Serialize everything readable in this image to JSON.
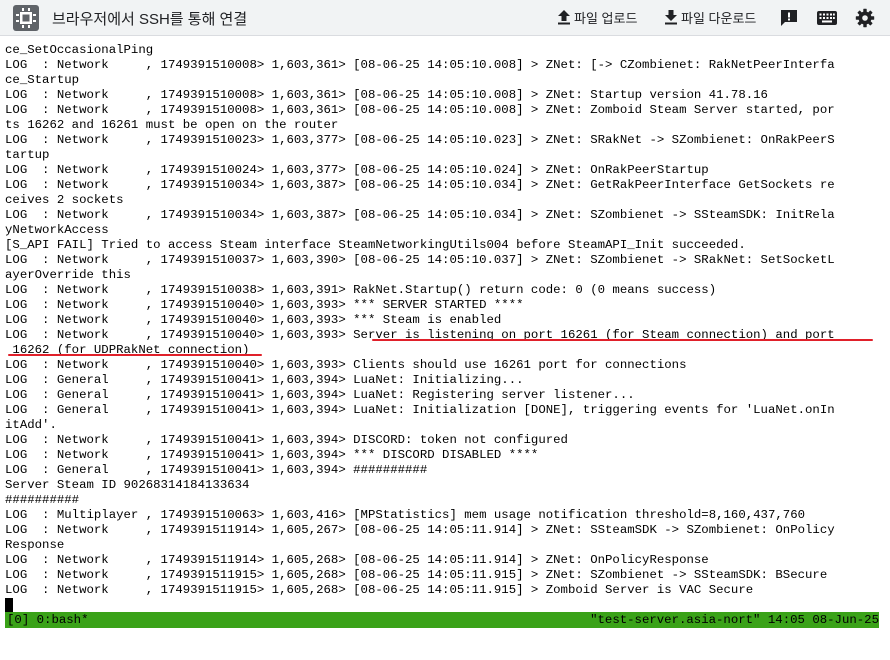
{
  "header": {
    "title": "브라우저에서 SSH를 통해 연결",
    "upload_label": "파일 업로드",
    "download_label": "파일 다운로드",
    "icons": [
      "app-chip-icon",
      "upload-icon",
      "download-icon",
      "feedback-icon",
      "keyboard-icon",
      "settings-gear-icon"
    ],
    "accent_color": "#5f6368"
  },
  "terminal": {
    "lines": [
      "ce_SetOccasionalPing",
      "LOG  : Network     , 1749391510008> 1,603,361> [08-06-25 14:05:10.008] > ZNet: [-> CZombienet: RakNetPeerInterfa",
      "ce_Startup",
      "LOG  : Network     , 1749391510008> 1,603,361> [08-06-25 14:05:10.008] > ZNet: Startup version 41.78.16",
      "LOG  : Network     , 1749391510008> 1,603,361> [08-06-25 14:05:10.008] > ZNet: Zomboid Steam Server started, por",
      "ts 16262 and 16261 must be open on the router",
      "LOG  : Network     , 1749391510023> 1,603,377> [08-06-25 14:05:10.023] > ZNet: SRakNet -> SZombienet: OnRakPeerS",
      "tartup",
      "LOG  : Network     , 1749391510024> 1,603,377> [08-06-25 14:05:10.024] > ZNet: OnRakPeerStartup",
      "LOG  : Network     , 1749391510034> 1,603,387> [08-06-25 14:05:10.034] > ZNet: GetRakPeerInterface GetSockets re",
      "ceives 2 sockets",
      "LOG  : Network     , 1749391510034> 1,603,387> [08-06-25 14:05:10.034] > ZNet: SZombienet -> SSteamSDK: InitRela",
      "yNetworkAccess",
      "[S_API FAIL] Tried to access Steam interface SteamNetworkingUtils004 before SteamAPI_Init succeeded.",
      "LOG  : Network     , 1749391510037> 1,603,390> [08-06-25 14:05:10.037] > ZNet: SZombienet -> SRakNet: SetSocketL",
      "ayerOverride this",
      "LOG  : Network     , 1749391510038> 1,603,391> RakNet.Startup() return code: 0 (0 means success)",
      "LOG  : Network     , 1749391510040> 1,603,393> *** SERVER STARTED ****",
      "LOG  : Network     , 1749391510040> 1,603,393> *** Steam is enabled",
      "LOG  : Network     , 1749391510040> 1,603,393> Server is listening on port 16261 (for Steam connection) and port",
      " 16262 (for UDPRakNet connection)",
      "LOG  : Network     , 1749391510040> 1,603,393> Clients should use 16261 port for connections",
      "LOG  : General     , 1749391510041> 1,603,394> LuaNet: Initializing...",
      "LOG  : General     , 1749391510041> 1,603,394> LuaNet: Registering server listener...",
      "LOG  : General     , 1749391510041> 1,603,394> LuaNet: Initialization [DONE], triggering events for 'LuaNet.onIn",
      "itAdd'.",
      "LOG  : Network     , 1749391510041> 1,603,394> DISCORD: token not configured",
      "LOG  : Network     , 1749391510041> 1,603,394> *** DISCORD DISABLED ****",
      "LOG  : General     , 1749391510041> 1,603,394> ##########",
      "Server Steam ID 90268314184133634",
      "##########",
      "LOG  : Multiplayer , 1749391510063> 1,603,416> [MPStatistics] mem usage notification threshold=8,160,437,760",
      "LOG  : Network     , 1749391511914> 1,605,267> [08-06-25 14:05:11.914] > ZNet: SSteamSDK -> SZombienet: OnPolicy",
      "Response",
      "LOG  : Network     , 1749391511914> 1,605,268> [08-06-25 14:05:11.914] > ZNet: OnPolicyResponse",
      "LOG  : Network     , 1749391511915> 1,605,268> [08-06-25 14:05:11.915] > ZNet: SZombienet -> SSteamSDK: BSecure",
      "LOG  : Network     , 1749391511915> 1,605,268> [08-06-25 14:05:11.915] > Zomboid Server is VAC Secure"
    ],
    "highlight_color": "#e0202a",
    "cursor": true
  },
  "statusbar": {
    "left": "[0] 0:bash*",
    "right": "\"test-server.asia-nort\" 14:05 08-Jun-25",
    "color": "#3aa218"
  }
}
